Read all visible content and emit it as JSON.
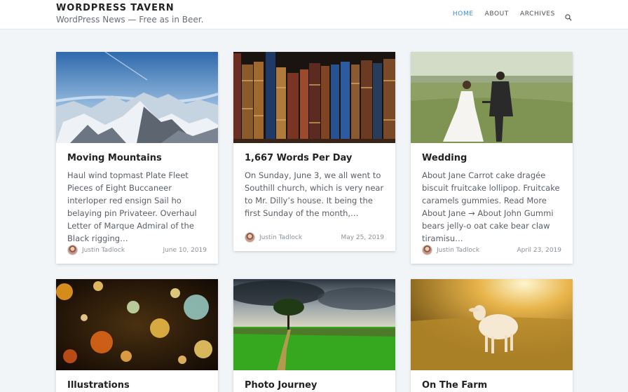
{
  "site": {
    "title": "WORDPRESS TAVERN",
    "description": "WordPress News — Free as in Beer."
  },
  "nav": {
    "items": [
      {
        "label": "HOME",
        "active": true
      },
      {
        "label": "ABOUT",
        "active": false
      },
      {
        "label": "ARCHIVES",
        "active": false
      }
    ],
    "search_icon": "search-icon"
  },
  "posts": [
    {
      "title": "Moving Mountains",
      "excerpt": "Haul wind topmast Plate Fleet Pieces of Eight Buccaneer interloper red ensign Sail ho belaying pin Privateer. Overhaul Letter of Marque Admiral of the Black rigging…",
      "author": "Justin Tadlock",
      "date": "June 10, 2019",
      "image": "snowy-mountains"
    },
    {
      "title": "1,667 Words Per Day",
      "excerpt": "On Sunday, June 3, we all went to Southill church, which is very near to Mr. Dilly’s house. It being the first Sunday of the month,…",
      "author": "Justin Tadlock",
      "date": "May 25, 2019",
      "image": "old-books"
    },
    {
      "title": "Wedding",
      "excerpt": "About Jane Carrot cake dragée biscuit fruitcake lollipop. Fruitcake caramels gummies. Read More About Jane → About John Gummi bears jelly-o oat cake bear claw tiramisu…",
      "author": "Justin Tadlock",
      "date": "April 23, 2019",
      "image": "wedding-couple"
    },
    {
      "title": "Illustrations",
      "image": "bokeh-lights"
    },
    {
      "title": "Photo Journey",
      "image": "tree-field"
    },
    {
      "title": "On The Farm",
      "image": "lamb-sunset"
    }
  ]
}
